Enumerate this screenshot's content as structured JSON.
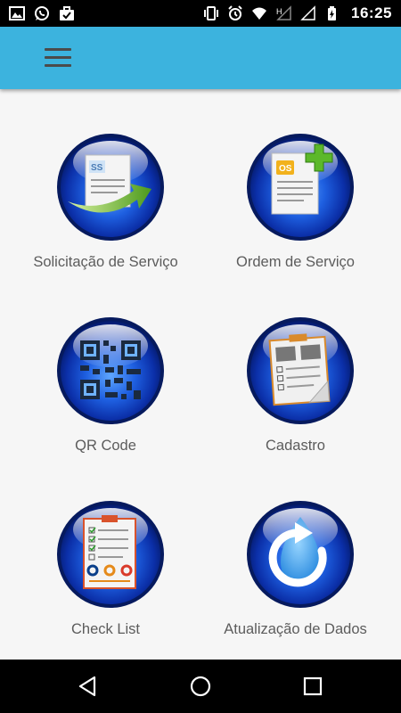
{
  "status_bar": {
    "time": "16:25",
    "left_icons": [
      "image-icon",
      "whatsapp-icon",
      "briefcase-check-icon"
    ],
    "right_icons": [
      "vibrate-icon",
      "alarm-icon",
      "wifi-icon",
      "signal-h-icon",
      "signal-icon",
      "battery-charging-icon"
    ],
    "network_label": "H"
  },
  "app_bar": {
    "menu_icon": "hamburger-menu-icon",
    "color": "#3cb3de"
  },
  "tiles": [
    {
      "label": "Solicitação de Serviço",
      "badge": "SS"
    },
    {
      "label": "Ordem de Serviço",
      "badge": "OS"
    },
    {
      "label": "QR Code"
    },
    {
      "label": "Cadastro"
    },
    {
      "label": "Check List"
    },
    {
      "label": "Atualização de Dados"
    }
  ],
  "nav_bar": {
    "buttons": [
      "back-icon",
      "home-icon",
      "recents-icon"
    ]
  }
}
